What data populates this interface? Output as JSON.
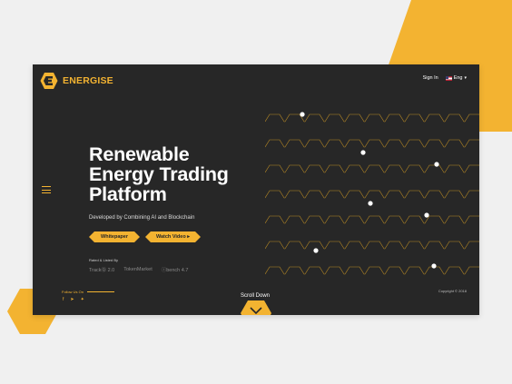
{
  "brand": {
    "name": "ENERGISE",
    "accent": "#f3b331",
    "background": "#272727"
  },
  "nav": {
    "sign_in": "Sign In",
    "language": "Eng",
    "language_icon": "us-flag-icon"
  },
  "hero": {
    "headline_lines": [
      "Renewable",
      "Energy Trading",
      "Platform"
    ],
    "subtitle": "Developed by Combining AI and Blockchain"
  },
  "buttons": {
    "whitepaper": "Whitepaper",
    "watch_video": "Watch Video ▸"
  },
  "rated": {
    "label": "Rated & Listed By",
    "partners": [
      "TrackⓆ 2.0",
      "TokenMarket",
      "ⓘbench 4.7"
    ]
  },
  "follow": {
    "label": "Follow Us On",
    "icons": [
      "facebook-icon",
      "telegram-icon",
      "twitter-icon"
    ]
  },
  "footer": {
    "copyright": "Copyright © 2018",
    "scroll": "Scroll Down"
  }
}
